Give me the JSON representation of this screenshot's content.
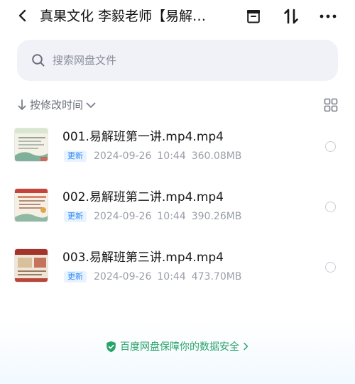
{
  "header": {
    "title": "真果文化 李毅老师【易解…",
    "back_icon": "chevron-left-icon",
    "actions": [
      "archive-icon",
      "sort-arrows-icon",
      "more-icon"
    ]
  },
  "search": {
    "placeholder": "搜索网盘文件"
  },
  "sort": {
    "label": "按修改时间",
    "direction_icon": "arrow-down-icon",
    "view_icon": "grid-view-icon"
  },
  "files": [
    {
      "name": "001.易解班第一讲.mp4.mp4",
      "badge": "更新",
      "date": "2024-09-26",
      "time": "10:44",
      "size": "360.08MB"
    },
    {
      "name": "002.易解班第二讲.mp4.mp4",
      "badge": "更新",
      "date": "2024-09-26",
      "time": "10:44",
      "size": "390.26MB"
    },
    {
      "name": "003.易解班第三讲.mp4.mp4",
      "badge": "更新",
      "date": "2024-09-26",
      "time": "10:44",
      "size": "473.70MB"
    }
  ],
  "footer": {
    "text": "百度网盘保障你的数据安全",
    "accent": "#2aa36b"
  },
  "colors": {
    "badge_text": "#2e8cf5",
    "badge_bg": "#e9f3ff",
    "search_bg": "#f1f2f8"
  }
}
